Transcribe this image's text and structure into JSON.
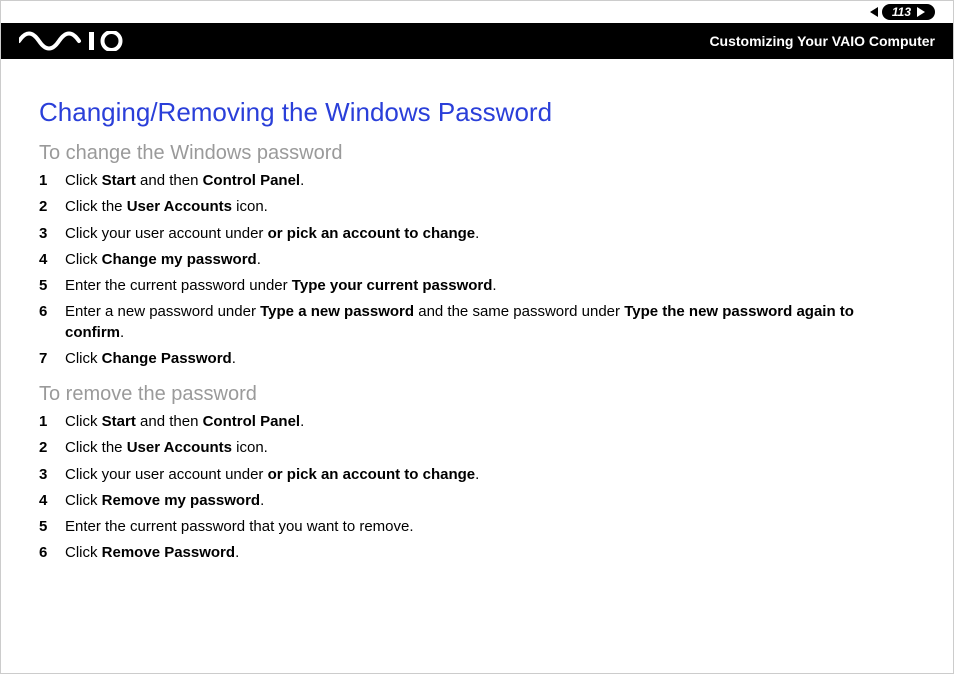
{
  "header": {
    "page_number": "113",
    "section_title": "Customizing Your VAIO Computer",
    "logo_alt": "VAIO"
  },
  "title": "Changing/Removing the Windows Password",
  "groups": [
    {
      "heading": "To change the Windows password",
      "steps": [
        [
          {
            "t": "Click "
          },
          {
            "b": "Start"
          },
          {
            "t": " and then "
          },
          {
            "b": "Control Panel"
          },
          {
            "t": "."
          }
        ],
        [
          {
            "t": "Click the "
          },
          {
            "b": "User Accounts"
          },
          {
            "t": " icon."
          }
        ],
        [
          {
            "t": "Click your user account under "
          },
          {
            "b": "or pick an account to change"
          },
          {
            "t": "."
          }
        ],
        [
          {
            "t": "Click "
          },
          {
            "b": "Change my password"
          },
          {
            "t": "."
          }
        ],
        [
          {
            "t": "Enter the current password under "
          },
          {
            "b": "Type your current password"
          },
          {
            "t": "."
          }
        ],
        [
          {
            "t": "Enter a new password under "
          },
          {
            "b": "Type a new password"
          },
          {
            "t": " and the same password under "
          },
          {
            "b": "Type the new password again to confirm"
          },
          {
            "t": "."
          }
        ],
        [
          {
            "t": "Click "
          },
          {
            "b": "Change Password"
          },
          {
            "t": "."
          }
        ]
      ]
    },
    {
      "heading": "To remove the password",
      "steps": [
        [
          {
            "t": "Click "
          },
          {
            "b": "Start"
          },
          {
            "t": " and then "
          },
          {
            "b": "Control Panel"
          },
          {
            "t": "."
          }
        ],
        [
          {
            "t": "Click the "
          },
          {
            "b": "User Accounts"
          },
          {
            "t": " icon."
          }
        ],
        [
          {
            "t": "Click your user account under "
          },
          {
            "b": "or pick an account to change"
          },
          {
            "t": "."
          }
        ],
        [
          {
            "t": "Click "
          },
          {
            "b": "Remove my password"
          },
          {
            "t": "."
          }
        ],
        [
          {
            "t": "Enter the current password that you want to remove."
          }
        ],
        [
          {
            "t": "Click "
          },
          {
            "b": "Remove Password"
          },
          {
            "t": "."
          }
        ]
      ]
    }
  ]
}
